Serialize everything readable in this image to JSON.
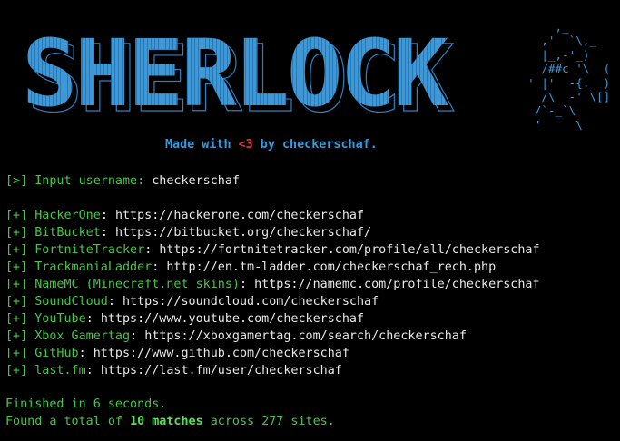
{
  "colors": {
    "background": "#000000",
    "green": "#4cc34c",
    "bright_green": "#55e055",
    "white": "#e8e8e8",
    "blue": "#3a9ad9",
    "blue_outline": "#2e7ec0",
    "heart_red": "#e03a3a"
  },
  "banner": {
    "logo_text": "SHERLOCK",
    "detective_ascii": "      ,_\n    ,'  `\\,_\n    |_,-'_)\n    /##c '\\  (\n  ' |'  -{.  )\n    /\\__-' \\[]\n   /`-_`\\\n   '     \\",
    "tagline_prefix": "Made with ",
    "tagline_heart": "<3",
    "tagline_suffix": " by checkerschaf."
  },
  "prompt": {
    "marker": "[>]",
    "label": " Input username:",
    "value": " checkerschaf"
  },
  "results": [
    {
      "marker": "[+]",
      "site": "HackerOne",
      "url": "https://hackerone.com/checkerschaf"
    },
    {
      "marker": "[+]",
      "site": "BitBucket",
      "url": "https://bitbucket.org/checkerschaf/"
    },
    {
      "marker": "[+]",
      "site": "FortniteTracker",
      "url": "https://fortnitetracker.com/profile/all/checkerschaf"
    },
    {
      "marker": "[+]",
      "site": "TrackmaniaLadder",
      "url": "http://en.tm-ladder.com/checkerschaf_rech.php"
    },
    {
      "marker": "[+]",
      "site": "NameMC (Minecraft.net skins)",
      "url": "https://namemc.com/profile/checkerschaf"
    },
    {
      "marker": "[+]",
      "site": "SoundCloud",
      "url": "https://soundcloud.com/checkerschaf"
    },
    {
      "marker": "[+]",
      "site": "YouTube",
      "url": "https://www.youtube.com/checkerschaf"
    },
    {
      "marker": "[+]",
      "site": "Xbox Gamertag",
      "url": "https://xboxgamertag.com/search/checkerschaf"
    },
    {
      "marker": "[+]",
      "site": "GitHub",
      "url": "https://www.github.com/checkerschaf"
    },
    {
      "marker": "[+]",
      "site": "last.fm",
      "url": "https://last.fm/user/checkerschaf"
    }
  ],
  "summary": {
    "finished": "Finished in 6 seconds.",
    "found_prefix": "Found a total of ",
    "found_count": "10 matches",
    "found_suffix": " across 277 sites."
  }
}
